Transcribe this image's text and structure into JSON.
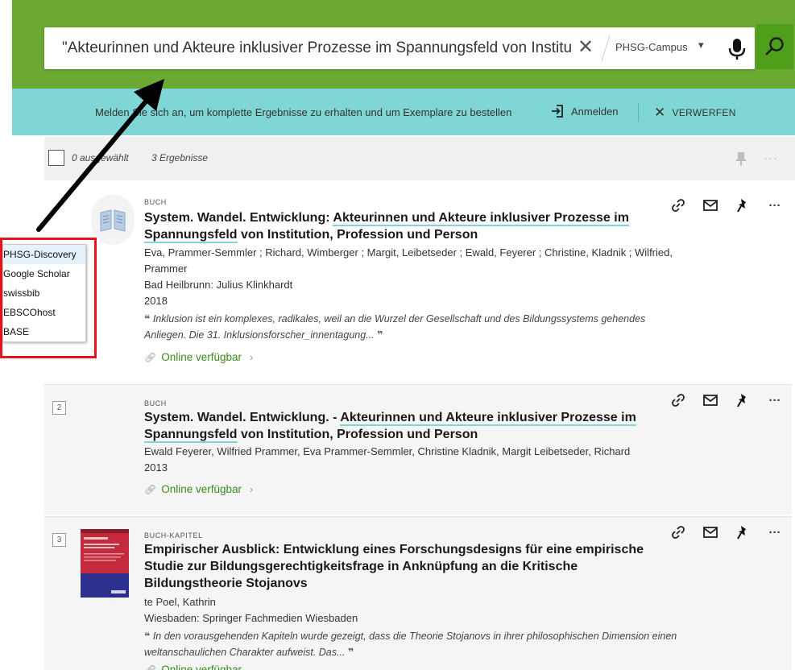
{
  "search": {
    "query": "\"Akteurinnen und Akteure inklusiver Prozesse im Spannungsfeld von Institutio",
    "clear_glyph": "✕",
    "scope": "PHSG-Campus",
    "scope_caret": "▾"
  },
  "notice": {
    "text": "Melden Sie sich an, um komplette Ergebnisse zu erhalten und um Exemplare zu bestellen",
    "login_label": "Anmelden",
    "dismiss_label": "VERWERFEN",
    "dismiss_glyph": "✕"
  },
  "toolbar": {
    "selected": "0 ausgewählt",
    "results": "3 Ergebnisse",
    "more_glyph": "···"
  },
  "results": [
    {
      "rank": "",
      "type": "BUCH",
      "title_pre": "System. Wandel. Entwicklung: ",
      "title_hl1": "Akteurinnen und Akteure inklusiver Prozesse im",
      "title_hl2": "Spannungsfeld",
      "title_post": " von Institution, Profession und Person",
      "authors_l1": "Eva, Prammer-Semmler ; Richard, Wimberger ; Margit, Leibetseder ; Ewald, Feyerer ; Christine, Kladnik ; Wilfried,",
      "authors_l2": "Prammer",
      "publisher": "Bad Heilbrunn: Julius Klinkhardt",
      "year": "2018",
      "snippet_l1": "Inklusion ist ein komplexes, radikales, weil an die Wurzel der Gesellschaft und des Bildungssystems gehendes",
      "snippet_l2": "Anliegen. Die 31. Inklusionsforscher_innentagung...",
      "online": "Online verfügbar"
    },
    {
      "rank": "2",
      "type": "BUCH",
      "title_pre": "System. Wandel. Entwicklung. - ",
      "title_hl1": "Akteurinnen und Akteure inklusiver Prozesse im",
      "title_hl2": "Spannungsfeld",
      "title_post": " von Institution, Profession und Person",
      "authors_l1": "Ewald Feyerer, Wilfried Prammer, Eva Prammer-Semmler, Christine Kladnik, Margit Leibetseder, Richard",
      "year": "2013",
      "online": "Online verfügbar"
    },
    {
      "rank": "3",
      "type": "BUCH-KAPITEL",
      "title_l1": "Empirischer Ausblick: Entwicklung eines Forschungsdesigns für eine empirische",
      "title_l2": "Studie zur Bildungsgerechtigkeitsfrage in Anknüpfung an die Kritische",
      "title_l3": "Bildungstheorie Stojanovs",
      "authors_l1": "te Poel, Kathrin",
      "publisher": "Wiesbaden: Springer Fachmedien Wiesbaden",
      "snippet_l1": "In den vorausgehenden Kapiteln wurde gezeigt, dass die Theorie Stojanovs in ihrer philosophischen Dimension einen",
      "snippet_l2": "weltanschaulichen Charakter aufweist. Das...",
      "online": "Online verfügbar"
    }
  ],
  "quote_open": "❝",
  "quote_close": "❞",
  "more_glyph": "···",
  "popup": {
    "items": [
      "PHSG-Discovery",
      "Google Scholar",
      "swissbib",
      "EBSCOhost",
      "BASE"
    ],
    "selected_index": 0
  },
  "colors": {
    "header_green": "#6ca932",
    "search_button": "#4f9e1a",
    "notice_teal": "#7fd6d4",
    "online_green": "#3c8a1e",
    "annotation_red": "#e8141d"
  }
}
